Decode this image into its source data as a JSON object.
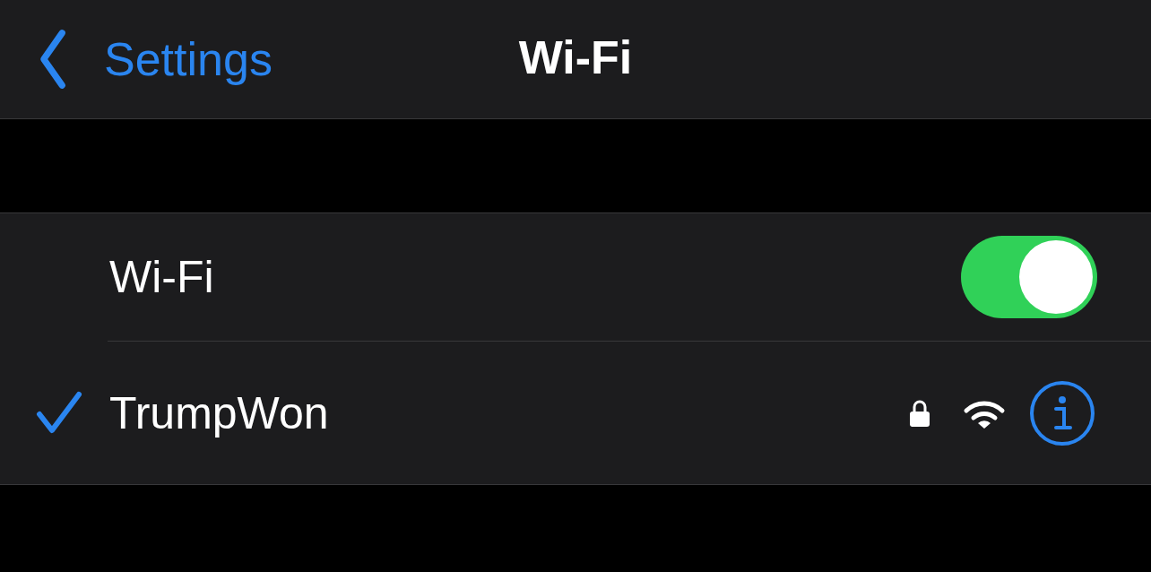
{
  "nav": {
    "back_label": "Settings",
    "title": "Wi-Fi"
  },
  "wifi_row": {
    "label": "Wi-Fi",
    "on": true
  },
  "networks": [
    {
      "name": "TrumpWon",
      "selected": true,
      "locked": true
    }
  ]
}
